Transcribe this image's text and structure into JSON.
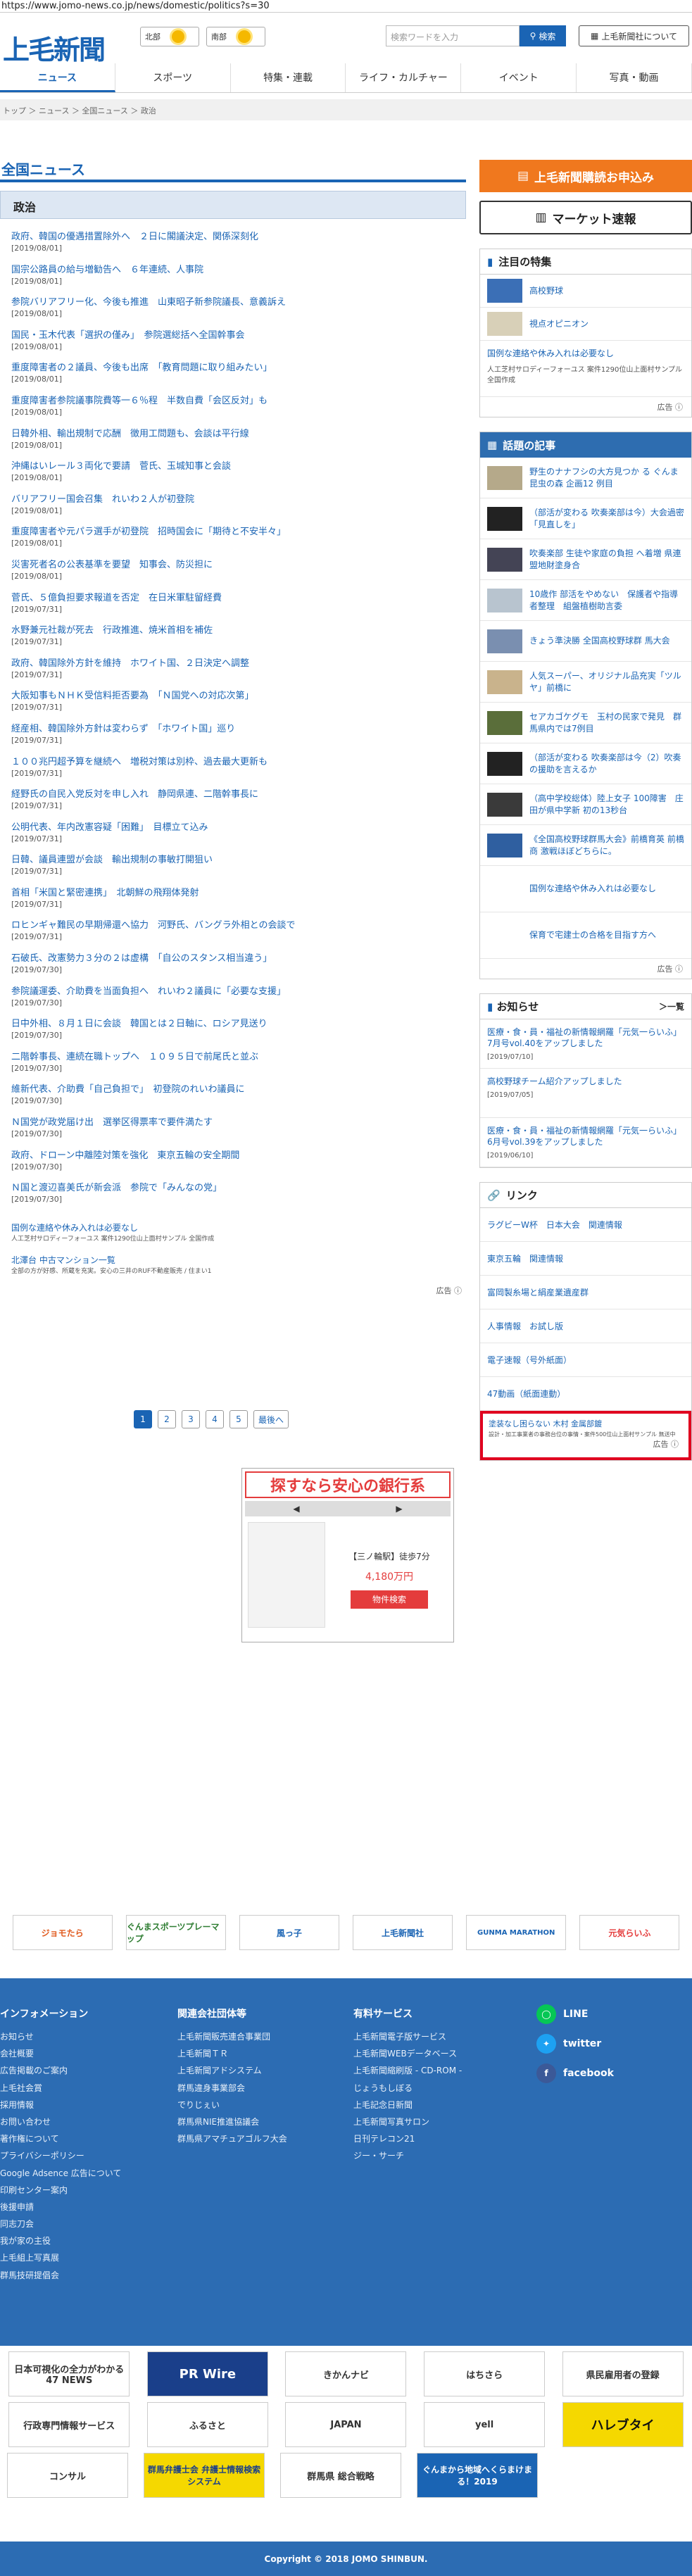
{
  "browser": {
    "url": "https://www.jomo-news.co.jp/news/domestic/politics?s=30"
  },
  "header": {
    "logo": "上毛新聞",
    "weather": [
      {
        "area": "北部",
        "icon": "sun-icon"
      },
      {
        "area": "南部",
        "icon": "sun-icon"
      }
    ],
    "search_placeholder": "検索ワードを入力",
    "search_button": "検索",
    "about_button": "上毛新聞社について"
  },
  "nav": [
    "ニュース",
    "スポーツ",
    "特集・連載",
    "ライフ・カルチャー",
    "イベント",
    "写真・動画"
  ],
  "breadcrumb": "トップ ＞ ニュース ＞ 全国ニュース ＞ 政治",
  "section_title": "全国ニュース",
  "category": "政治",
  "news": [
    {
      "title": "政府、韓国の優遇措置除外へ　２日に閣議決定、関係深刻化",
      "date": "[2019/08/01]"
    },
    {
      "title": "国宗公路員の給与増勧告へ　６年連続、人事院",
      "date": "[2019/08/01]"
    },
    {
      "title": "参院バリアフリー化、今後も推進　山東昭子新参院議長、意義訴え",
      "date": "[2019/08/01]"
    },
    {
      "title": "国民・玉木代表「選択の僅み」　参院選総括へ全国幹事会",
      "date": "[2019/08/01]"
    },
    {
      "title": "重度障害者の２議員、今後も出席　「教育問題に取り組みたい」",
      "date": "[2019/08/01]"
    },
    {
      "title": "重度障害者参院議事院費等一６％程　半数自費「会区反対」も",
      "date": "[2019/08/01]"
    },
    {
      "title": "日韓外相、輸出規制で応酬　徴用工問題も、会談は平行線",
      "date": "[2019/08/01]"
    },
    {
      "title": "沖縄はいレール３両化で要請　菅氏、玉城知事と会談",
      "date": "[2019/08/01]"
    },
    {
      "title": "バリアフリー国会召集　れいわ２人が初登院",
      "date": "[2019/08/01]"
    },
    {
      "title": "重度障害者や元パラ選手が初登院　招時国会に「期待と不安半々」",
      "date": "[2019/08/01]"
    },
    {
      "title": "災害死者名の公表基準を要望　知事会、防災担に",
      "date": "[2019/08/01]"
    },
    {
      "title": "菅氏、５億負担要求報道を否定　在日米軍駐留経費",
      "date": "[2019/07/31]"
    },
    {
      "title": "水野兼元社裁が死去　行政推進、焼米首相を補佐",
      "date": "[2019/07/31]"
    },
    {
      "title": "政府、韓国除外方針を維持　ホワイト国、２日決定へ調整",
      "date": "[2019/07/31]"
    },
    {
      "title": "大阪知事もＮＨＫ受信料拒否要為　「Ｎ国党への対応次第」",
      "date": "[2019/07/31]"
    },
    {
      "title": "経産相、韓国除外方針は変わらず　「ホワイト国」巡り",
      "date": "[2019/07/31]"
    },
    {
      "title": "１００兆円超予算を継続へ　増税対策は別枠、過去最大更新も",
      "date": "[2019/07/31]"
    },
    {
      "title": "経野氏の自民入党反対を申し入れ　静岡県連、二階幹事長に",
      "date": "[2019/07/31]"
    },
    {
      "title": "公明代表、年内改憲容疑「困難」　目標立て込み",
      "date": "[2019/07/31]"
    },
    {
      "title": "日韓、議員連盟が会談　輸出規制の事敏打開狙い",
      "date": "[2019/07/31]"
    },
    {
      "title": "首相「米国と緊密連携」　北朝鮮の飛翔体発射",
      "date": "[2019/07/31]"
    },
    {
      "title": "ロヒンギャ難民の早期帰還へ協力　河野氏、バングラ外相との会談で",
      "date": "[2019/07/31]"
    },
    {
      "title": "石破氏、改憲勢力３分の２は虚構　「自公のスタンス相当違う」",
      "date": "[2019/07/30]"
    },
    {
      "title": "参院議運委、介助費を当面負担へ　れいわ２議員に「必要な支援」",
      "date": "[2019/07/30]"
    },
    {
      "title": "日中外相、８月１日に会談　韓国とは２日軸に、ロシア見送り",
      "date": "[2019/07/30]"
    },
    {
      "title": "二階幹事長、連続在職トップへ　１０９５日で前尾氏と並ぶ",
      "date": "[2019/07/30]"
    },
    {
      "title": "維新代表、介助費「自己負担で」　初登院のれいわ議員に",
      "date": "[2019/07/30]"
    },
    {
      "title": "Ｎ国党が政党届け出　選挙区得票率で要件満たす",
      "date": "[2019/07/30]"
    },
    {
      "title": "政府、ドローン中離陸対策を強化　東京五輪の安全期間",
      "date": "[2019/07/30]"
    },
    {
      "title": "Ｎ国と渡辺喜美氏が新会派　参院で「みんなの党」",
      "date": "[2019/07/30]"
    }
  ],
  "main_ads": [
    {
      "title": "国例な連絡や休み入れは必要なし",
      "sub": "人工芝村サロディーフォーユス 案件1290位山上面村サンプル 全国作成"
    },
    {
      "title": "北澤台 中古マンション一覧",
      "sub": "全部の方が好感、所蔵を充実。安心の三井のRUF不動産販売 / 住まい1"
    }
  ],
  "ad_label": "広告 ⓘ",
  "pager": {
    "pages": [
      "1",
      "2",
      "3",
      "4",
      "5"
    ],
    "current": "1",
    "next": "最後へ"
  },
  "bank_ad": {
    "heading": "探すなら安心の銀行系",
    "floor": "【三ノ輪駅】徒歩7分",
    "price": "4,180万円",
    "button": "物件検索"
  },
  "side": {
    "subscribe": "上毛新聞購読お申込み",
    "market": "マーケット速報",
    "featured": {
      "title": "注目の特集",
      "items": [
        "高校野球",
        "視点オピニオン"
      ],
      "ad_title": "国例な連絡や休み入れは必要なし",
      "ad_sub": "人工芝村サロディーフォーユス 案件1290位山上面村サンプル 全国作成"
    },
    "topics": {
      "title": "話題の記事",
      "items": [
        "野生のナナフシの大方見つか る ぐんま昆虫の森 企画12 例目",
        "（部活が変わる 吹奏楽部は今）大会過密「見直しを」",
        "吹奏楽部 生徒や家庭の負担 へ着増 県連盟地財塗身合",
        "10歳作 部活をやめない　保護者や指導者整理　組盤植樹助言委",
        "きょう準決勝 全国高校野球群 馬大会",
        "人気スーパー、オリジナル品充実「ツルヤ」前橋に",
        "セアカゴケグモ　玉村の民家で発見　群馬県内では7例目",
        "（部活が変わる 吹奏楽部は今（2）吹奏の援助を言えるか",
        "（高中学校総体）陸上女子 100障害　庄田が県中学新 初の13秒台",
        "《全国高校野球群馬大会》前橋育英 前橋商 激戦ほぼどちらに。",
        "国例な連絡や休み入れは必要なし",
        "保育で宅建士の合格を目指す方へ"
      ]
    },
    "notices": {
      "title": "お知らせ",
      "more": "＞一覧",
      "items": [
        {
          "title": "医療・食・員・福祉の新情報網羅「元気一らいふ」7月号vol.40をアップしました",
          "date": "[2019/07/10]"
        },
        {
          "title": "高校野球チーム紹介アップしました",
          "date": "[2019/07/05]"
        },
        {
          "title": "医療・食・員・福祉の新情報網羅「元気一らいふ」6月号vol.39をアップしました",
          "date": "[2019/06/10]"
        }
      ]
    },
    "links": {
      "title": "リンク",
      "items": [
        "ラグビーW杯　日本大会　関連情報",
        "東京五輪　関連情報",
        "富岡製糸場と絹産業遺産群",
        "人事情報　お試し版",
        "電子速報（号外紙面）",
        "47動画（紙面連動）"
      ]
    },
    "red_ad": {
      "title": "塗装なし困らない 木村 金属部鍍",
      "sub": "設計・加工事業者の事務台位の事情・案件500位山上面村サンプル 無送中"
    }
  },
  "banners": [
    "ジョモたら",
    "ぐんまスポーツプレーマップ",
    "風っ子",
    "上毛新聞社",
    "GUNMA MARATHON",
    "元気らいふ"
  ],
  "footer": {
    "info": {
      "title": "インフォメーション",
      "items": [
        "お知らせ",
        "会社概要",
        "広告掲載のご案内",
        "上毛社会賞",
        "採用情報",
        "お問い合わせ",
        "著作権について",
        "プライバシーポリシー",
        "Google Adsence 広告について",
        "印刷センター案内",
        "後援申請",
        "同志刀会",
        "我が家の主役",
        "上毛組上写真展",
        "群馬技研提倡会"
      ]
    },
    "related": {
      "title": "関連会社団体等",
      "items": [
        "上毛新聞販売連合事業団",
        "上毛新聞ＴＲ",
        "上毛新聞アドシステム",
        "群馬違身事業部会",
        "でりじぇい",
        "群馬県NIE推進協議会",
        "群馬県アマチュアゴルフ大会"
      ]
    },
    "services": {
      "title": "有料サービス",
      "items": [
        "上毛新聞電子版サービス",
        "上毛新聞WEBデータベース",
        "上毛新聞縮刷版 ‐ CD-ROM ‐",
        "じょうもしぼる",
        "上毛記念日新聞",
        "上毛新聞写真サロン",
        "日刊テレコン21",
        "ジー・サーチ"
      ]
    },
    "social": [
      {
        "name": "LINE",
        "color": "#06c755"
      },
      {
        "name": "twitter",
        "color": "#1da1f2"
      },
      {
        "name": "facebook",
        "color": "#3b5998"
      }
    ]
  },
  "bottom_ads": [
    "日本可視化の全力がわかる 47 NEWS",
    "PR Wire",
    "きかんナビ",
    "はちさら",
    "県民雇用者の登録",
    "行政専門情報サービス",
    "ふるさと",
    "JAPAN",
    "yell",
    "ハレブタイ",
    "コンサル",
    "群馬弁護士会 弁護士情報検索システム",
    "群馬県 総合戦略",
    "ぐんまから地域へくらまけまる！2019"
  ],
  "copyright": "Copyright © 2018 JOMO SHINBUN."
}
